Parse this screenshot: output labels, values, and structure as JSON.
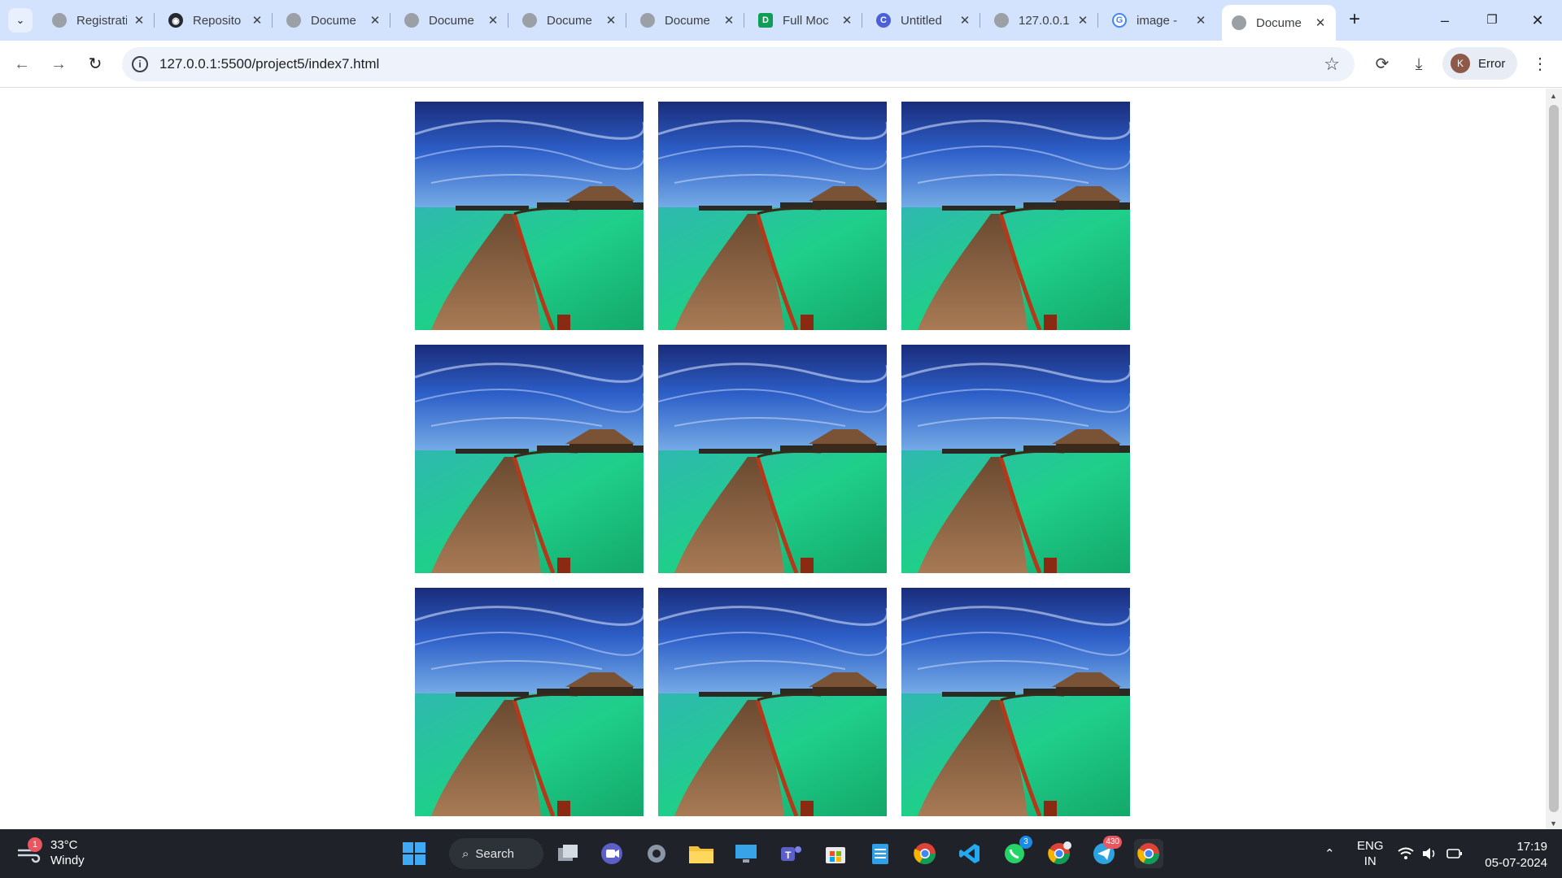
{
  "browser": {
    "tabs": [
      {
        "title": "Registrati",
        "icon": "globe-icon"
      },
      {
        "title": "Reposito",
        "icon": "github-icon"
      },
      {
        "title": "Docume",
        "icon": "globe-icon"
      },
      {
        "title": "Docume",
        "icon": "globe-icon"
      },
      {
        "title": "Docume",
        "icon": "globe-icon"
      },
      {
        "title": "Docume",
        "icon": "globe-icon"
      },
      {
        "title": "Full Moc",
        "icon": "doc-icon"
      },
      {
        "title": "Untitled",
        "icon": "canva-icon"
      },
      {
        "title": "127.0.0.1",
        "icon": "globe-icon"
      },
      {
        "title": "image -",
        "icon": "google-icon"
      },
      {
        "title": "Docume",
        "icon": "globe-icon",
        "active": true
      }
    ],
    "url": "127.0.0.1:5500/project5/index7.html",
    "profile": {
      "initial": "K",
      "label": "Error"
    }
  },
  "page": {
    "images": [
      {
        "alt": "overwater walkway"
      },
      {
        "alt": "overwater walkway"
      },
      {
        "alt": "overwater walkway"
      },
      {
        "alt": "overwater walkway"
      },
      {
        "alt": "overwater walkway"
      },
      {
        "alt": "overwater walkway"
      },
      {
        "alt": "overwater walkway"
      },
      {
        "alt": "overwater walkway"
      },
      {
        "alt": "overwater walkway"
      }
    ]
  },
  "taskbar": {
    "weather": {
      "temp": "33°C",
      "condition": "Windy",
      "badge": "1"
    },
    "search_label": "Search",
    "whatsapp_badge": "3",
    "telegram_badge": "430",
    "language": {
      "line1": "ENG",
      "line2": "IN"
    },
    "clock": {
      "time": "17:19",
      "date": "05-07-2024"
    }
  },
  "colors": {
    "tabstrip": "#d3e3fd",
    "taskbar": "#1f2329",
    "accent": "#1a73e8"
  }
}
